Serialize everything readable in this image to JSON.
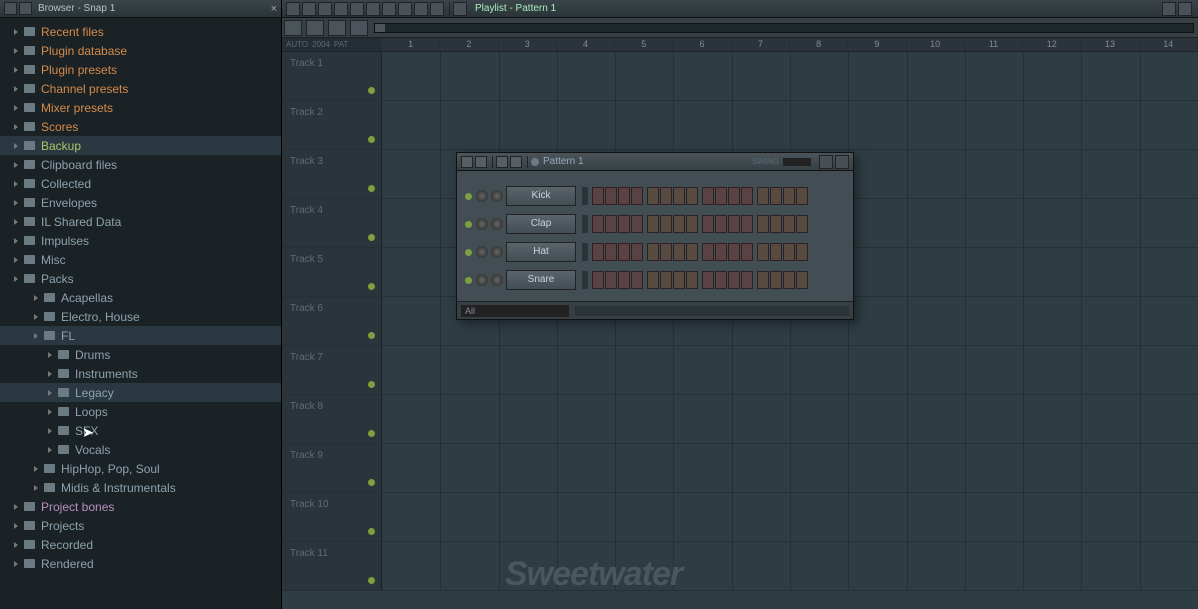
{
  "browser": {
    "title": "Browser - Snap 1",
    "tree": [
      {
        "type": "orange",
        "label": "Recent files"
      },
      {
        "type": "orange",
        "label": "Plugin database"
      },
      {
        "type": "orange",
        "label": "Plugin presets"
      },
      {
        "type": "orange",
        "label": "Channel presets"
      },
      {
        "type": "orange",
        "label": "Mixer presets"
      },
      {
        "type": "orange",
        "label": "Scores"
      },
      {
        "type": "green",
        "label": "Backup",
        "hl": true
      },
      {
        "type": "grey",
        "label": "Clipboard files"
      },
      {
        "type": "grey",
        "label": "Collected"
      },
      {
        "type": "grey",
        "label": "Envelopes"
      },
      {
        "type": "grey",
        "label": "IL Shared Data"
      },
      {
        "type": "grey",
        "label": "Impulses"
      },
      {
        "type": "grey",
        "label": "Misc"
      },
      {
        "type": "grey",
        "label": "Packs"
      },
      {
        "type": "grey",
        "label": "Acapellas",
        "indent": 1
      },
      {
        "type": "grey",
        "label": "Electro, House",
        "indent": 1
      },
      {
        "type": "grey",
        "label": "FL",
        "indent": 1,
        "hl": true
      },
      {
        "type": "grey",
        "label": "Drums",
        "indent": 2
      },
      {
        "type": "grey",
        "label": "Instruments",
        "indent": 2
      },
      {
        "type": "grey",
        "label": "Legacy",
        "indent": 2,
        "hl": true
      },
      {
        "type": "grey",
        "label": "Loops",
        "indent": 2
      },
      {
        "type": "grey",
        "label": "SFX",
        "indent": 2
      },
      {
        "type": "grey",
        "label": "Vocals",
        "indent": 2
      },
      {
        "type": "grey",
        "label": "HipHop, Pop, Soul",
        "indent": 1
      },
      {
        "type": "grey",
        "label": "Midis & Instrumentals",
        "indent": 1
      },
      {
        "type": "purple",
        "label": "Project bones"
      },
      {
        "type": "grey",
        "label": "Projects"
      },
      {
        "type": "grey",
        "label": "Recorded"
      },
      {
        "type": "grey",
        "label": "Rendered"
      }
    ]
  },
  "playlist": {
    "title": "Playlist - Pattern 1",
    "ruler_left": [
      "AUTO",
      "2004",
      "PAT"
    ],
    "bars": [
      "1",
      "2",
      "3",
      "4",
      "5",
      "6",
      "7",
      "8",
      "9",
      "10",
      "11",
      "12",
      "13",
      "14"
    ],
    "tracks": [
      "Track 1",
      "Track 2",
      "Track 3",
      "Track 4",
      "Track 5",
      "Track 6",
      "Track 7",
      "Track 8",
      "Track 9",
      "Track 10",
      "Track 11"
    ]
  },
  "rack": {
    "title": "Pattern 1",
    "swing_label": "SWING",
    "channels": [
      "Kick",
      "Clap",
      "Hat",
      "Snare"
    ],
    "filter": "All"
  },
  "watermark": "Sweetwater"
}
